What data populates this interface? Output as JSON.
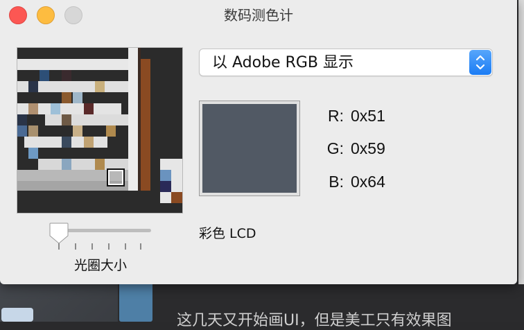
{
  "window": {
    "title": "数码测色计"
  },
  "popup": {
    "selected": "以 Adobe RGB 显示"
  },
  "swatch": {
    "color": "#515964"
  },
  "readout": {
    "r_key": "R:",
    "r_val": "0x51",
    "g_key": "G:",
    "g_val": "0x59",
    "b_key": "B:",
    "b_val": "0x64"
  },
  "profile": "彩色 LCD",
  "slider": {
    "label": "光圈大小",
    "value_fraction": 0.0
  },
  "background": {
    "caption": "这几天又开始画UI，但是美工只有效果图"
  },
  "colors": {
    "accent": "#1b7cf4",
    "close": "#fc5753",
    "minimize": "#fdbc40"
  }
}
